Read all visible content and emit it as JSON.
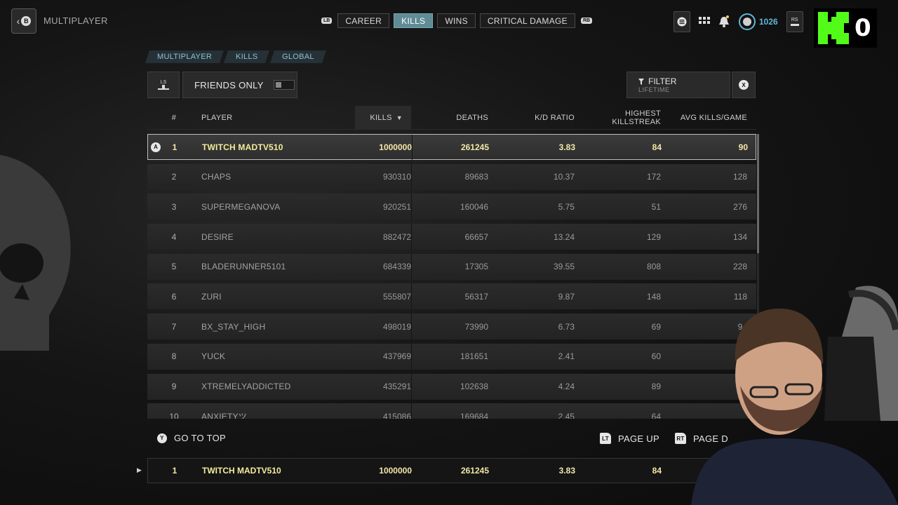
{
  "header": {
    "back_label": "B",
    "title": "MULTIPLAYER",
    "left_bumper": "LB",
    "right_bumper": "RB",
    "tabs": [
      {
        "label": "CAREER",
        "active": false
      },
      {
        "label": "KILLS",
        "active": true
      },
      {
        "label": "WINS",
        "active": false
      },
      {
        "label": "CRITICAL DAMAGE",
        "active": false
      }
    ],
    "level": "1026",
    "rs_label": "RS",
    "overlay_count": "0"
  },
  "breadcrumb": [
    "MULTIPLAYER",
    "KILLS",
    "GLOBAL"
  ],
  "controls": {
    "sort_stick_label": "LS",
    "friends_only_label": "FRIENDS ONLY",
    "friends_only_on": false,
    "filter_label": "FILTER",
    "filter_value": "LIFETIME",
    "close_label": "X"
  },
  "table": {
    "columns": {
      "rank": "#",
      "player": "PLAYER",
      "kills": "KILLS",
      "deaths": "DEATHS",
      "kd": "K/D RATIO",
      "streak_line1": "HIGHEST",
      "streak_line2": "KILLSTREAK",
      "avg": "AVG KILLS/GAME"
    },
    "rows": [
      {
        "rank": "1",
        "player": "TWITCH MADTV510",
        "kills": "1000000",
        "deaths": "261245",
        "kd": "3.83",
        "streak": "84",
        "avg": "90"
      },
      {
        "rank": "2",
        "player": "CHAPS",
        "kills": "930310",
        "deaths": "89683",
        "kd": "10.37",
        "streak": "172",
        "avg": "128"
      },
      {
        "rank": "3",
        "player": "SUPERMEGANOVA",
        "kills": "920251",
        "deaths": "160046",
        "kd": "5.75",
        "streak": "51",
        "avg": "276"
      },
      {
        "rank": "4",
        "player": "DESIRE",
        "kills": "882472",
        "deaths": "66657",
        "kd": "13.24",
        "streak": "129",
        "avg": "134"
      },
      {
        "rank": "5",
        "player": "BLADERUNNER5101",
        "kills": "684339",
        "deaths": "17305",
        "kd": "39.55",
        "streak": "808",
        "avg": "228"
      },
      {
        "rank": "6",
        "player": "ZURI",
        "kills": "555807",
        "deaths": "56317",
        "kd": "9.87",
        "streak": "148",
        "avg": "118"
      },
      {
        "rank": "7",
        "player": "BX_STAY_HIGH",
        "kills": "498019",
        "deaths": "73990",
        "kd": "6.73",
        "streak": "69",
        "avg": "94"
      },
      {
        "rank": "8",
        "player": "YUCK",
        "kills": "437969",
        "deaths": "181651",
        "kd": "2.41",
        "streak": "60",
        "avg": ""
      },
      {
        "rank": "9",
        "player": "XTREMELYADDICTED",
        "kills": "435291",
        "deaths": "102638",
        "kd": "4.24",
        "streak": "89",
        "avg": ""
      },
      {
        "rank": "10",
        "player": "ANXIETYツ",
        "kills": "415086",
        "deaths": "169684",
        "kd": "2.45",
        "streak": "64",
        "avg": ""
      }
    ],
    "selected_badge": "A"
  },
  "footer": {
    "go_top_button": "Y",
    "go_top_label": "GO TO TOP",
    "page_up_trigger": "LT",
    "page_up_label": "PAGE UP",
    "page_down_trigger": "RT",
    "page_down_label": "PAGE D"
  },
  "player_row": {
    "rank": "1",
    "player": "TWITCH MADTV510",
    "kills": "1000000",
    "deaths": "261245",
    "kd": "3.83",
    "streak": "84"
  },
  "colors": {
    "accent": "#5f8c95",
    "highlight_text": "#f4ec9d",
    "overlay_green": "#53fc18"
  }
}
